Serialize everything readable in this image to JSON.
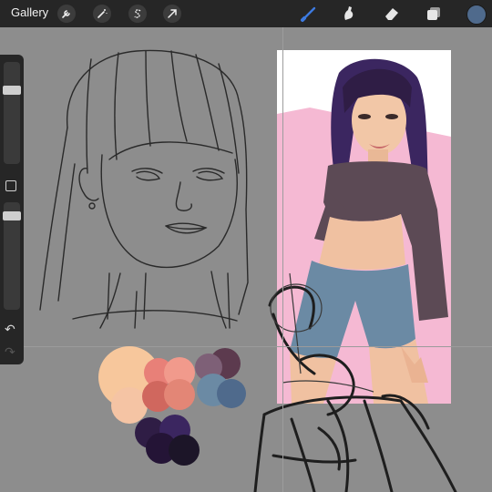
{
  "topbar": {
    "gallery_label": "Gallery",
    "left_tools": [
      "wrench-icon",
      "magic-wand-icon",
      "selection-s-icon",
      "transform-arrow-icon"
    ],
    "right_tools": [
      "brush-icon",
      "smudge-icon",
      "eraser-icon",
      "layers-icon"
    ],
    "active_tool": "brush-icon",
    "accent_color": "#3d7ae0",
    "current_color": "#4f6a8c"
  },
  "sidebar": {
    "brush_size_level": 0.85,
    "opacity_level": 0.9,
    "undo_icon": "undo-arrow-icon",
    "redo_icon": "redo-arrow-icon"
  },
  "palette": {
    "swatches": [
      "#f7c79c",
      "#f5c4a4",
      "#e88078",
      "#f19a8c",
      "#d0675e",
      "#e38676",
      "#5c3a4e",
      "#7e6077",
      "#6b8aa4",
      "#4f6a8c",
      "#2f1d45",
      "#3b2660",
      "#241436",
      "#1c1528"
    ]
  },
  "colors": {
    "canvas_gray": "#8d8d8d",
    "toolbar": "#262626",
    "reference_bg": "#ffffff",
    "reference_pink": "#f5b9d3"
  }
}
